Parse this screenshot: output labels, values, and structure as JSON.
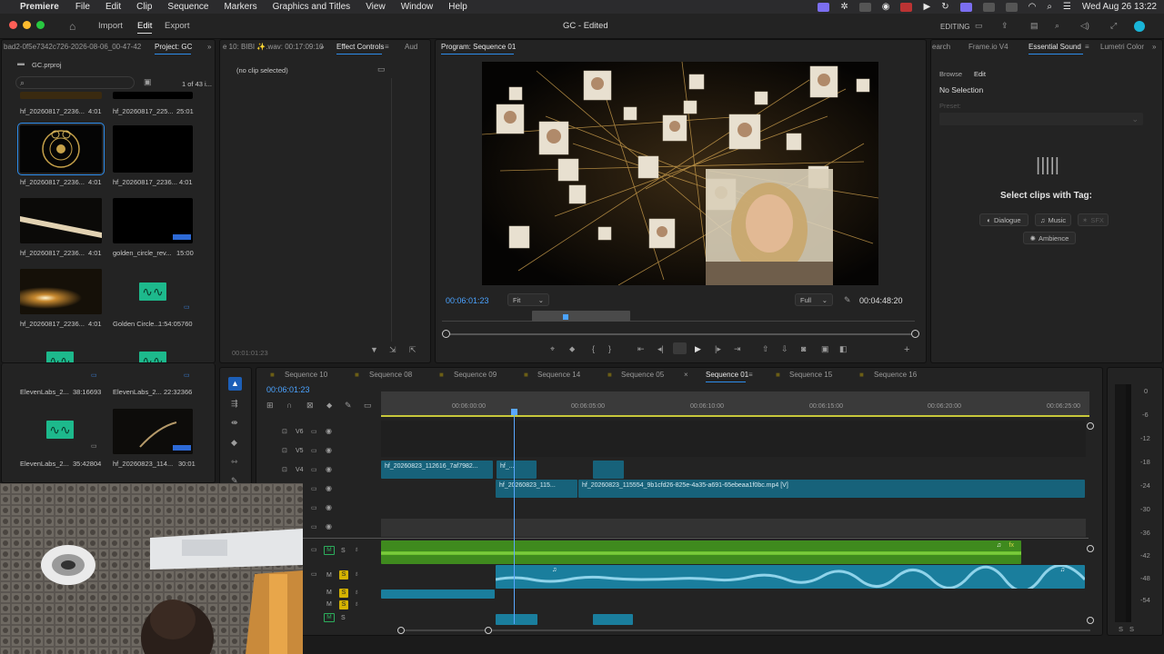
{
  "mac_menubar": {
    "app_name": "Premiere",
    "items": [
      "File",
      "Edit",
      "Clip",
      "Sequence",
      "Markers",
      "Graphics and Titles",
      "View",
      "Window",
      "Help"
    ],
    "datetime": "Wed Aug 26  13:22"
  },
  "app_header": {
    "workspace_tabs": [
      "Import",
      "Edit",
      "Export"
    ],
    "title": "GC - Edited",
    "editing_label": "EDITING"
  },
  "project_panel": {
    "tab_left": "bad2-0f5e7342c726-2026-08-06_00-47-42",
    "tab_project": "Project: GC",
    "project_file": "GC.prproj",
    "item_count": "1 of 43 i...",
    "items": [
      {
        "name": "hf_20260817_2236...",
        "duration": "4:01"
      },
      {
        "name": "hf_20260817_225...",
        "duration": "25:01"
      },
      {
        "name": "hf_20260817_2236...",
        "duration": "4:01"
      },
      {
        "name": "hf_20260817_2236...",
        "duration": "4:01"
      },
      {
        "name": "hf_20260817_2236...",
        "duration": "4:01"
      },
      {
        "name": "golden_circle_rev...",
        "duration": "15:00"
      },
      {
        "name": "hf_20260817_2236...",
        "duration": "4:01"
      },
      {
        "name": "Golden Circle...",
        "duration": "1:54:05760"
      },
      {
        "name": "ElevenLabs_2...",
        "duration": "38:16693"
      },
      {
        "name": "ElevenLabs_2...",
        "duration": "22:32366"
      },
      {
        "name": "ElevenLabs_2...",
        "duration": "35:42804"
      },
      {
        "name": "hf_20260823_114...",
        "duration": "30:01"
      }
    ]
  },
  "source_panel": {
    "tab_source": "e 10: BIBI ✨.wav: 00:17:09:10",
    "tab_effects": "Effect Controls",
    "tab_audio": "Aud",
    "no_clip": "(no clip selected)",
    "timecode": "00:01:01:23"
  },
  "program_panel": {
    "tab": "Program: Sequence 01",
    "timecode": "00:06:01:23",
    "fit": "Fit",
    "quality": "Full",
    "duration": "00:04:48:20"
  },
  "right_panel": {
    "tabs": [
      "earch",
      "Frame.io V4",
      "Essential Sound",
      "Lumetri Color"
    ],
    "subtabs": [
      "Browse",
      "Edit"
    ],
    "no_selection": "No Selection",
    "preset_label": "Preset:",
    "select_clips": "Select clips with Tag:",
    "tags": [
      "Dialogue",
      "Music",
      "SFX",
      "Ambience"
    ]
  },
  "timeline": {
    "sequence_tabs": [
      "Sequence 10",
      "Sequence 08",
      "Sequence 09",
      "Sequence 14",
      "Sequence 05",
      "Sequence 01",
      "Sequence 15",
      "Sequence 16"
    ],
    "active_sequence": "Sequence 01",
    "timecode": "00:06:01:23",
    "ruler_ticks": [
      "00:06:00:00",
      "00:06:05:00",
      "00:06:10:00",
      "00:06:15:00",
      "00:06:20:00",
      "00:06:25:00"
    ],
    "video_tracks": [
      "V6",
      "V5",
      "V4"
    ],
    "clips": [
      {
        "name": "hf_20260823_112616_7af7982..."
      },
      {
        "name": "hf_..."
      },
      {
        "name": "hf_20260823_115..."
      },
      {
        "name": "hf_20260823_115554_9b1cfd26-825e-4a35-a691-65ebeaa1f0bc.mp4 [V]"
      }
    ],
    "track_toggles": {
      "m": "M",
      "s": "S"
    }
  },
  "meter": {
    "labels": [
      "0",
      "-6",
      "-12",
      "-18",
      "-24",
      "-30",
      "-36",
      "-42",
      "-48",
      "-54"
    ],
    "solo": [
      "S",
      "S"
    ]
  },
  "colors": {
    "accent": "#2d8ceb",
    "clip_video": "#17627a",
    "clip_audio": "#1a7e9d",
    "music_green": "#4e9a19",
    "playhead": "#5aa8ff"
  }
}
